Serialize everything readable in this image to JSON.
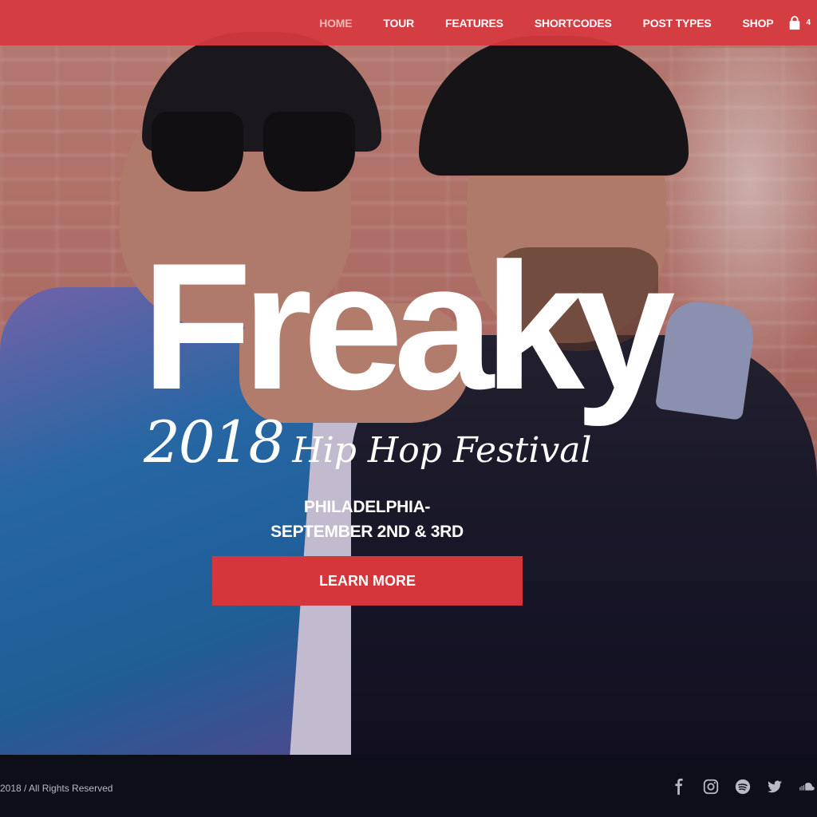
{
  "nav": {
    "items": [
      {
        "label": "HOME",
        "active": true
      },
      {
        "label": "TOUR"
      },
      {
        "label": "FEATURES"
      },
      {
        "label": "SHORTCODES"
      },
      {
        "label": "POST TYPES"
      },
      {
        "label": "SHOP"
      }
    ],
    "cart_icon": "shopping-bag-icon",
    "cart_count": "4"
  },
  "hero": {
    "title": "Freaky",
    "subtitle_year": "2018",
    "subtitle_rest": "Hip Hop Festival",
    "location_line1": "PHILADELPHIA-",
    "location_line2": "SEPTEMBER 2ND & 3RD",
    "cta_label": "LEARN MORE"
  },
  "footer": {
    "copyright": "2018 / All Rights Reserved",
    "socials": [
      "facebook-icon",
      "instagram-icon",
      "spotify-icon",
      "twitter-icon",
      "soundcloud-icon"
    ]
  },
  "colors": {
    "accent": "#d5363c",
    "nav_bg": "#d6393e",
    "footer_bg": "#0d0e1a",
    "text": "#ffffff"
  }
}
